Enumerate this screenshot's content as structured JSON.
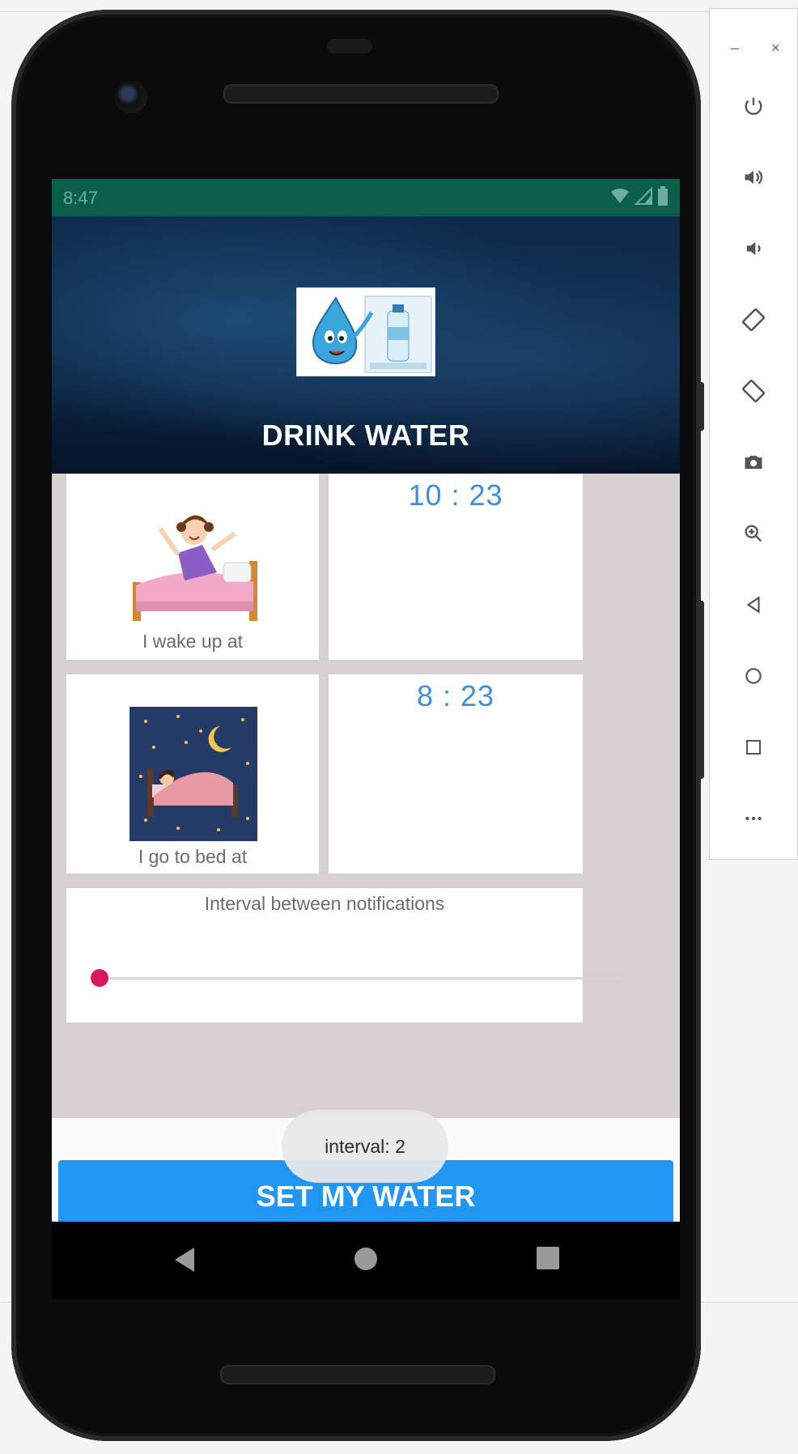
{
  "status_bar": {
    "time": "8:47"
  },
  "app": {
    "title": "DRINK WATER",
    "logo_icon": "water-drop-mascot-logo",
    "colors": {
      "status_bar": "#0a5e4a",
      "accent_blue": "#2196f3",
      "time_blue": "#3d8fe0",
      "slider_thumb": "#d6195c",
      "content_bg": "#d8cfd0"
    }
  },
  "wake": {
    "label": "I wake up at",
    "time": "10 : 23",
    "icon": "girl-waking-in-bed-illustration"
  },
  "sleep": {
    "label": "I go to bed at",
    "time": "8 : 23",
    "icon": "sleeping-at-night-illustration"
  },
  "interval": {
    "label": "Interval between notifications",
    "slider_value_fraction": 0.0
  },
  "toast": {
    "text": "interval: 2"
  },
  "button": {
    "label": "SET MY WATER"
  },
  "emulator": {
    "window_controls": [
      "–",
      "×"
    ],
    "tools": [
      "power-icon",
      "volume-up-icon",
      "volume-down-icon",
      "rotate-left-icon",
      "rotate-right-icon",
      "camera-icon",
      "zoom-icon",
      "back-icon",
      "home-icon",
      "overview-icon",
      "more-icon"
    ]
  }
}
